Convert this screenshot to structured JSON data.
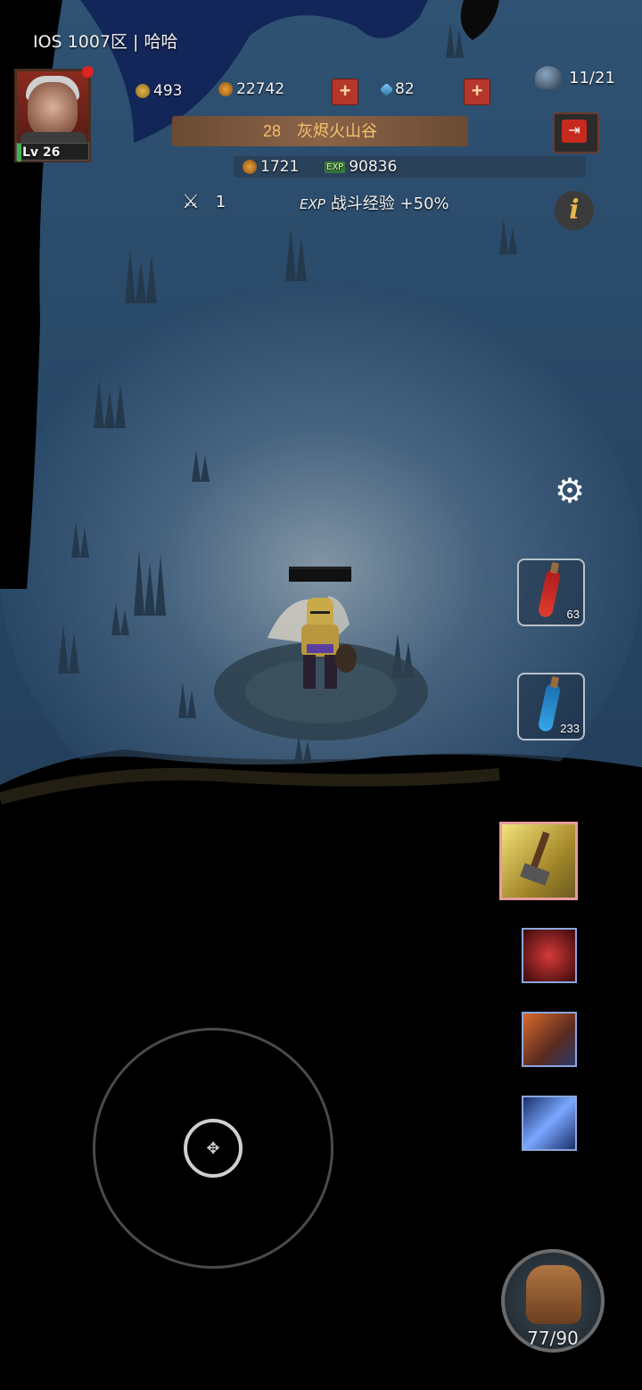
{
  "server": {
    "label": "IOS 1007区 | 哈哈"
  },
  "player": {
    "level": "Lv 26"
  },
  "resources": {
    "stars": "493",
    "gold": "22742",
    "gems": "82",
    "stamina": "11/21"
  },
  "zone": {
    "number": "28",
    "name": "灰烬火山谷"
  },
  "loot": {
    "gold": "1721",
    "exp_label": "EXP",
    "exp": "90836"
  },
  "battle": {
    "wave": "1",
    "bonus_label": "EXP",
    "bonus_text": "战斗经验 +50%"
  },
  "potions": {
    "health_count": "63",
    "mana_count": "233"
  },
  "inventory": {
    "capacity": "77/90"
  },
  "icons": {
    "swords": "⚔",
    "gear": "⚙",
    "info": "i",
    "exit": "⇥"
  },
  "colors": {
    "zone_text": "#f5c26b",
    "plus_button": "#b5362b",
    "skill_border_main": "#e79c9c",
    "skill_border": "#8aa6de"
  }
}
